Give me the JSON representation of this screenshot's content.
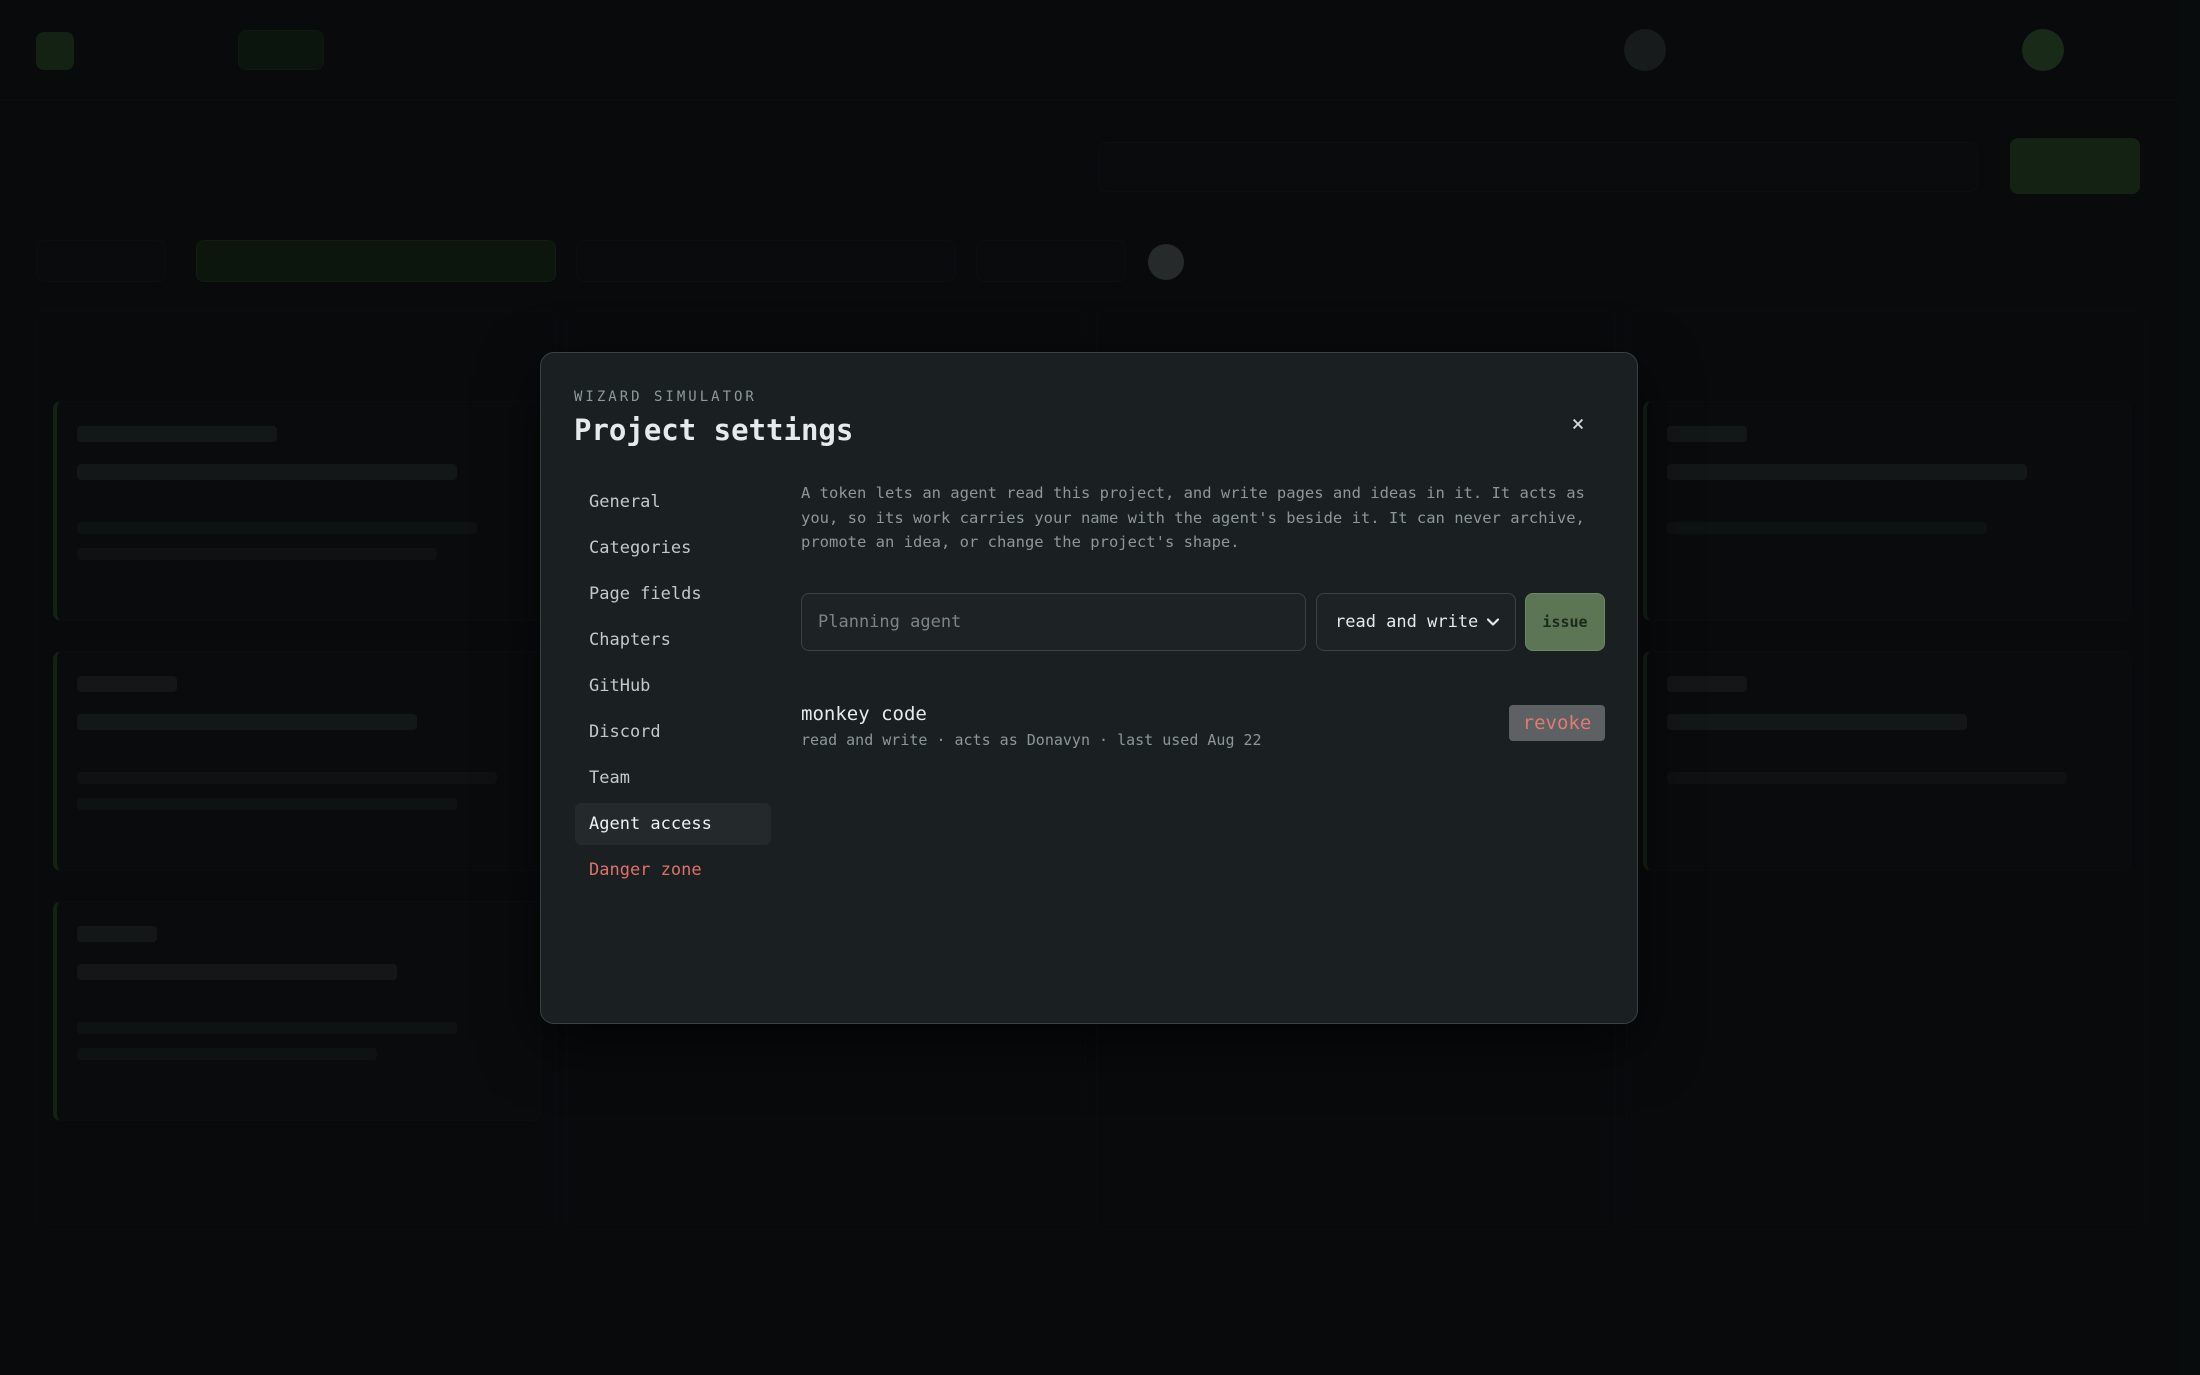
{
  "modal": {
    "eyebrow": "WIZARD SIMULATOR",
    "title": "Project settings",
    "close_glyph": "×"
  },
  "settings_nav": {
    "items": [
      {
        "label": "General",
        "active": false
      },
      {
        "label": "Categories",
        "active": false
      },
      {
        "label": "Page fields",
        "active": false
      },
      {
        "label": "Chapters",
        "active": false
      },
      {
        "label": "GitHub",
        "active": false
      },
      {
        "label": "Discord",
        "active": false
      },
      {
        "label": "Team",
        "active": false
      },
      {
        "label": "Agent access",
        "active": true
      },
      {
        "label": "Danger zone",
        "active": false,
        "danger": true
      }
    ]
  },
  "agent_access": {
    "description": "A token lets an agent read this project, and write pages and ideas in it. It acts as you, so its work carries your name with the agent's beside it. It can never archive, promote an idea, or change the project's shape.",
    "name_input": {
      "value": "",
      "placeholder": "Planning agent"
    },
    "permission_select": {
      "value": "read and write"
    },
    "issue_label": "issue",
    "tokens": [
      {
        "name": "monkey code",
        "meta": "read and write · acts as Donavyn · last used Aug 22",
        "revoke_label": "revoke"
      }
    ]
  },
  "colors": {
    "accent_green": "#5c7655",
    "danger": "#e0706a",
    "modal_bg": "#1a1f21"
  }
}
